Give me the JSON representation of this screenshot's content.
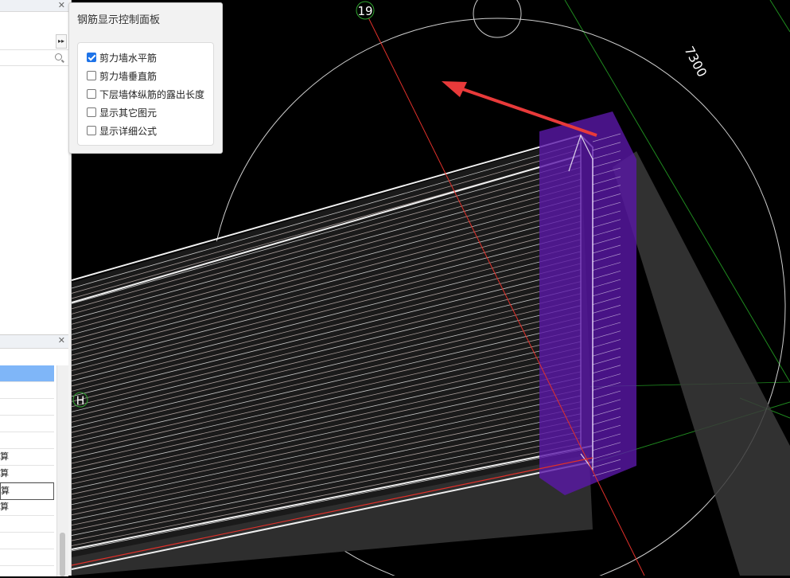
{
  "control_panel": {
    "title": "钢筋显示控制面板",
    "options": [
      {
        "label": "剪力墙水平筋",
        "checked": true
      },
      {
        "label": "剪力墙垂直筋",
        "checked": false
      },
      {
        "label": "下层墙体纵筋的露出长度",
        "checked": false
      },
      {
        "label": "显示其它图元",
        "checked": false
      },
      {
        "label": "显示详细公式",
        "checked": false
      }
    ]
  },
  "left_panel": {
    "close_glyph": "✕",
    "more_glyph": "▸▸",
    "rows": [
      {
        "text": "算"
      },
      {
        "text": "算"
      },
      {
        "text": "算"
      },
      {
        "text": "算"
      }
    ]
  },
  "viewport": {
    "axis_label_top": "19",
    "axis_label_left": "H",
    "dimension_label": "7300",
    "colors": {
      "background": "#000000",
      "axis_red": "#e0302a",
      "axis_green": "#2fa52f",
      "rebar": "#e8dcd8",
      "column": "#5a18a8",
      "arrow": "#e83a3a"
    }
  }
}
